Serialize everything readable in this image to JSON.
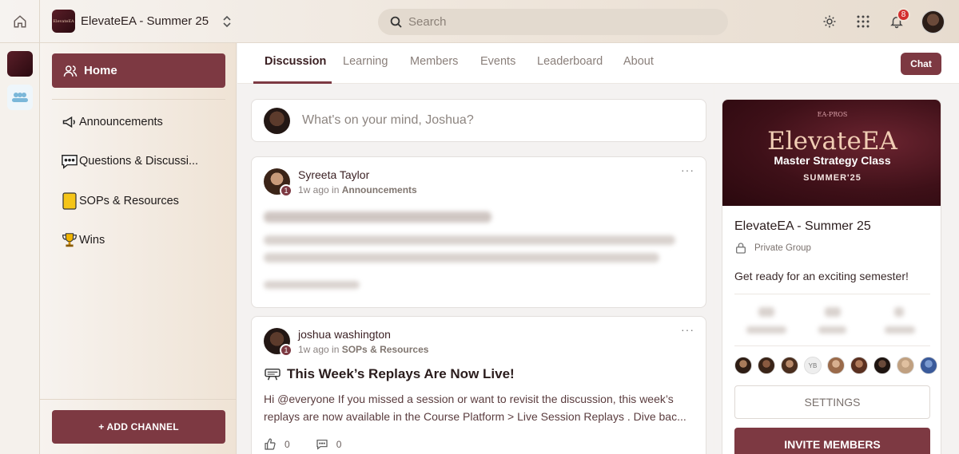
{
  "topbar": {
    "group_name": "ElevateEA - Summer 25",
    "logo_text": "ElevateEA",
    "search_placeholder": "Search",
    "notification_count": "8"
  },
  "sidebar": {
    "home_label": "Home",
    "channels": [
      {
        "label": "Announcements",
        "icon": "megaphone-icon"
      },
      {
        "label": "Questions & Discussi...",
        "icon": "speech-bubble-icon"
      },
      {
        "label": "SOPs & Resources",
        "icon": "folder-icon"
      },
      {
        "label": "Wins",
        "icon": "trophy-icon"
      }
    ],
    "add_channel_label": "+ ADD CHANNEL"
  },
  "tabs": {
    "items": [
      "Discussion",
      "Learning",
      "Members",
      "Events",
      "Leaderboard",
      "About"
    ],
    "active": "Discussion",
    "chat_label": "Chat"
  },
  "composer": {
    "placeholder": "What's on your mind, Joshua?"
  },
  "posts": [
    {
      "author": "Syreeta Taylor",
      "level": "1",
      "time": "1w ago in",
      "channel": "Announcements",
      "title_blurred": "Body Language - Facial Expressions",
      "body_blurred": "One thing that I struggle with is controlling my facial expressions. I have been told so more than one occasion that I can sit for times look unapproachable. I was..."
    },
    {
      "author": "joshua washington",
      "level": "1",
      "time": "1w ago in",
      "channel": "SOPs & Resources",
      "title": "This Week’s Replays Are Now Live!",
      "body": "Hi @everyone If you missed a session or want to revisit the discussion, this week’s replays are now available in the Course Platform > Live Session Replays . Dive bac...",
      "likes": "0",
      "comments": "0"
    }
  ],
  "group": {
    "banner_top": "EA-PROS",
    "banner_title": "ElevateEA",
    "banner_subtitle": "Master Strategy Class",
    "banner_season": "SUMMER'25",
    "name": "ElevateEA - Summer 25",
    "privacy": "Private Group",
    "description": "Get ready for an exciting semester!",
    "member_initials": "YB",
    "settings_label": "SETTINGS",
    "invite_label": "INVITE MEMBERS"
  },
  "colors": {
    "accent": "#7d3942",
    "badge": "#d32f2f"
  }
}
